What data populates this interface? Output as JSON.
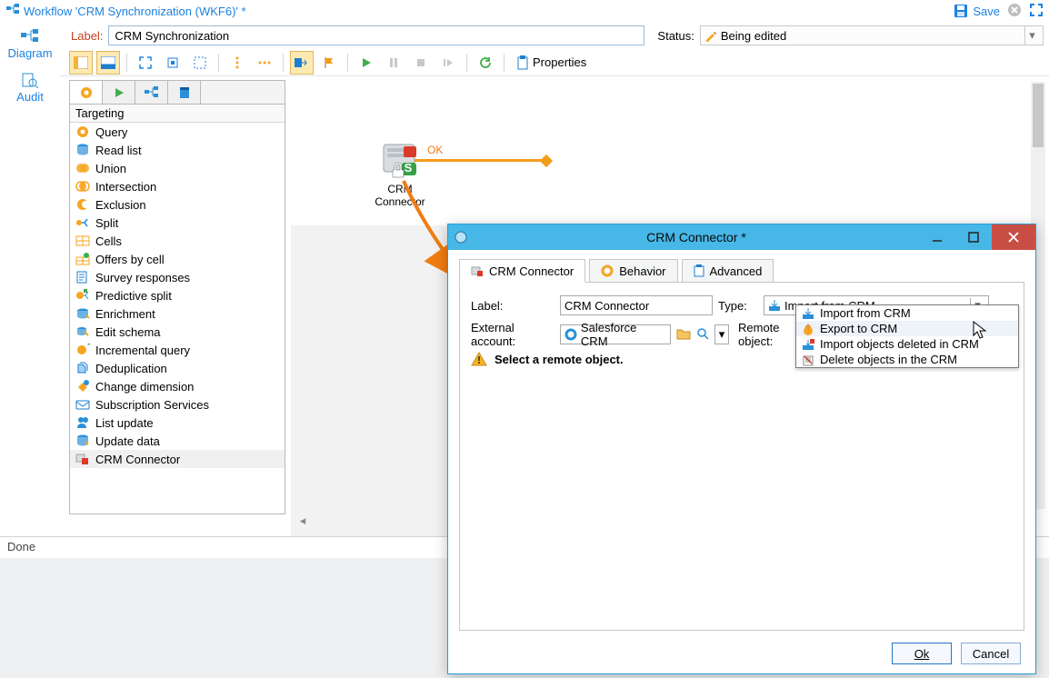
{
  "title": "Workflow 'CRM Synchronization (WKF6)' *",
  "save": "Save",
  "leftnav": {
    "diagram": "Diagram",
    "audit": "Audit"
  },
  "row2": {
    "label_caption": "Label:",
    "label_value": "CRM Synchronization",
    "status_caption": "Status:",
    "status_value": "Being edited"
  },
  "toolbar": {
    "properties": "Properties"
  },
  "palette": {
    "group": "Targeting",
    "items": [
      "Query",
      "Read list",
      "Union",
      "Intersection",
      "Exclusion",
      "Split",
      "Cells",
      "Offers by cell",
      "Survey responses",
      "Predictive split",
      "Enrichment",
      "Edit schema",
      "Incremental query",
      "Deduplication",
      "Change dimension",
      "Subscription Services",
      "List update",
      "Update data",
      "CRM Connector"
    ],
    "selected": "CRM Connector"
  },
  "canvas": {
    "node_label": "CRM Connector",
    "edge_label": "OK"
  },
  "status": "Done",
  "dialog": {
    "title": "CRM Connector *",
    "tabs": [
      "CRM Connector",
      "Behavior",
      "Advanced"
    ],
    "label_caption": "Label:",
    "label_value": "CRM Connector",
    "type_caption": "Type:",
    "type_value": "Import from CRM",
    "ext_caption": "External account:",
    "ext_value": "Salesforce CRM",
    "remote_caption": "Remote object:",
    "warning": "Select a remote object.",
    "type_options": [
      "Import from CRM",
      "Export to CRM",
      "Import objects deleted in CRM",
      "Delete objects in the CRM"
    ],
    "type_hover": "Export to CRM",
    "ok": "Ok",
    "cancel": "Cancel"
  }
}
